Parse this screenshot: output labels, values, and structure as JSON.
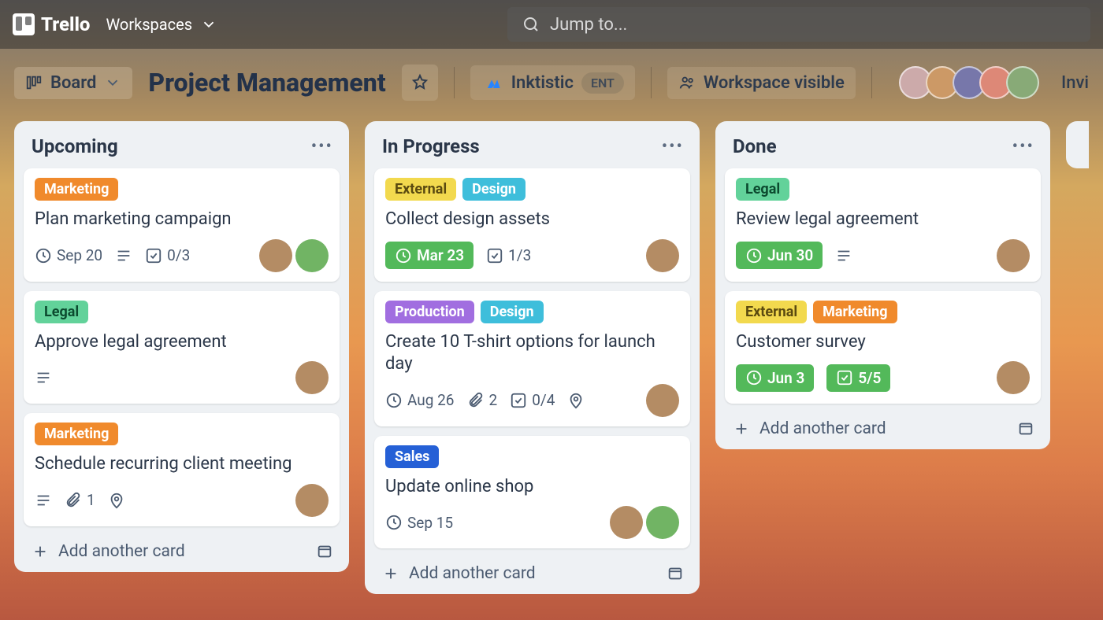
{
  "nav": {
    "brand": "Trello",
    "workspaces_label": "Workspaces",
    "search_placeholder": "Jump to..."
  },
  "board_header": {
    "view_label": "Board",
    "title": "Project Management",
    "org_name": "Inktistic",
    "org_badge": "ENT",
    "visibility_label": "Workspace visible",
    "invite_label": "Invi",
    "member_count": 5
  },
  "lists": [
    {
      "title": "Upcoming",
      "add_label": "Add another card",
      "cards": [
        {
          "labels": [
            {
              "text": "Marketing",
              "cls": "lbl-marketing"
            }
          ],
          "title": "Plan marketing campaign",
          "date": "Sep 20",
          "date_style": "plain",
          "has_desc": true,
          "checklist": "0/3",
          "members": 2
        },
        {
          "labels": [
            {
              "text": "Legal",
              "cls": "lbl-legal"
            }
          ],
          "title": "Approve legal agreement",
          "has_desc": true,
          "members": 1
        },
        {
          "labels": [
            {
              "text": "Marketing",
              "cls": "lbl-marketing"
            }
          ],
          "title": "Schedule recurring client meeting",
          "has_desc": true,
          "attachments": "1",
          "has_location": true,
          "members": 1
        }
      ]
    },
    {
      "title": "In Progress",
      "add_label": "Add another card",
      "cards": [
        {
          "labels": [
            {
              "text": "External",
              "cls": "lbl-external"
            },
            {
              "text": "Design",
              "cls": "lbl-design"
            }
          ],
          "title": "Collect design assets",
          "date": "Mar 23",
          "date_style": "green",
          "checklist": "1/3",
          "members": 1
        },
        {
          "labels": [
            {
              "text": "Production",
              "cls": "lbl-production"
            },
            {
              "text": "Design",
              "cls": "lbl-design"
            }
          ],
          "title": "Create 10 T-shirt options for launch day",
          "date": "Aug 26",
          "date_style": "plain",
          "attachments": "2",
          "checklist": "0/4",
          "has_location": true,
          "members": 1
        },
        {
          "labels": [
            {
              "text": "Sales",
              "cls": "lbl-sales"
            }
          ],
          "title": "Update online shop",
          "date": "Sep 15",
          "date_style": "plain",
          "members": 2
        }
      ]
    },
    {
      "title": "Done",
      "add_label": "Add another card",
      "cards": [
        {
          "labels": [
            {
              "text": "Legal",
              "cls": "lbl-legal"
            }
          ],
          "title": "Review legal agreement",
          "date": "Jun 30",
          "date_style": "green",
          "has_desc": true,
          "members": 1
        },
        {
          "labels": [
            {
              "text": "External",
              "cls": "lbl-external"
            },
            {
              "text": "Marketing",
              "cls": "lbl-marketing"
            }
          ],
          "title": "Customer survey",
          "date": "Jun 3",
          "date_style": "green",
          "checklist": "5/5",
          "checklist_style": "green",
          "members": 1
        }
      ]
    }
  ],
  "colors": {
    "marketing": "#f08a2c",
    "legal": "#62d29a",
    "external": "#f2d94e",
    "design": "#3ebedb",
    "production": "#a16ee0",
    "sales": "#2560d6",
    "badge_green": "#53b95a"
  }
}
